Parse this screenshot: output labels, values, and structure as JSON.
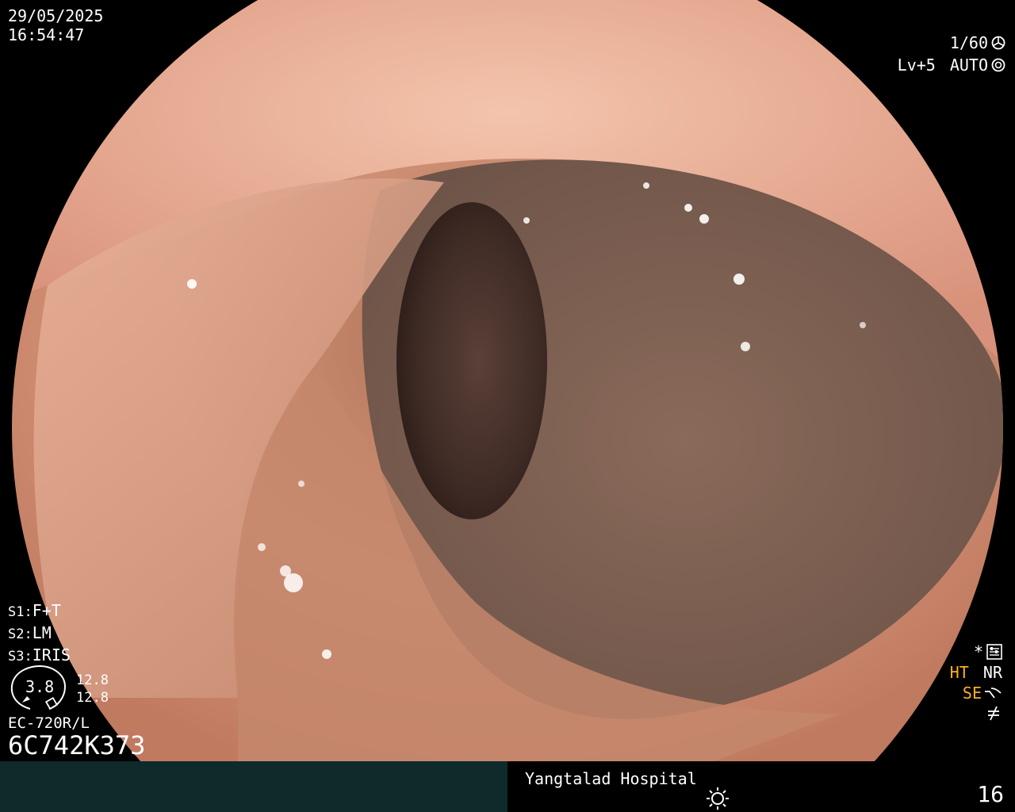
{
  "datetime": {
    "date": "29/05/2025",
    "time": "16:54:47"
  },
  "exposure": {
    "shutter": "1/60",
    "level": "Lv+5",
    "mode": "AUTO"
  },
  "settings": {
    "s1_key": "S1",
    "s1_value": "F+T",
    "s2_key": "S2",
    "s2_value": "LM",
    "s3_key": "S3",
    "s3_value": "IRIS"
  },
  "zoom_gauge": {
    "value": "3.8",
    "upper": "12.8",
    "lower": "12.8"
  },
  "scope": {
    "model": "EC-720R/L",
    "serial": "6C742K373"
  },
  "status_right": {
    "star": "*",
    "ht": "HT",
    "nr": "NR",
    "se": "SE"
  },
  "footer": {
    "hospital": "Yangtalad Hospital",
    "frame_number": "16"
  },
  "colors": {
    "accent_orange": "#ffb020",
    "footer_left_bg": "#0f2a2a"
  },
  "icons": [
    "shutter-icon",
    "auto-iris-icon",
    "settings-panel-icon",
    "enhance-curve-icon",
    "color-filter-icon",
    "light-sun-icon",
    "zoom-gauge-icon"
  ]
}
